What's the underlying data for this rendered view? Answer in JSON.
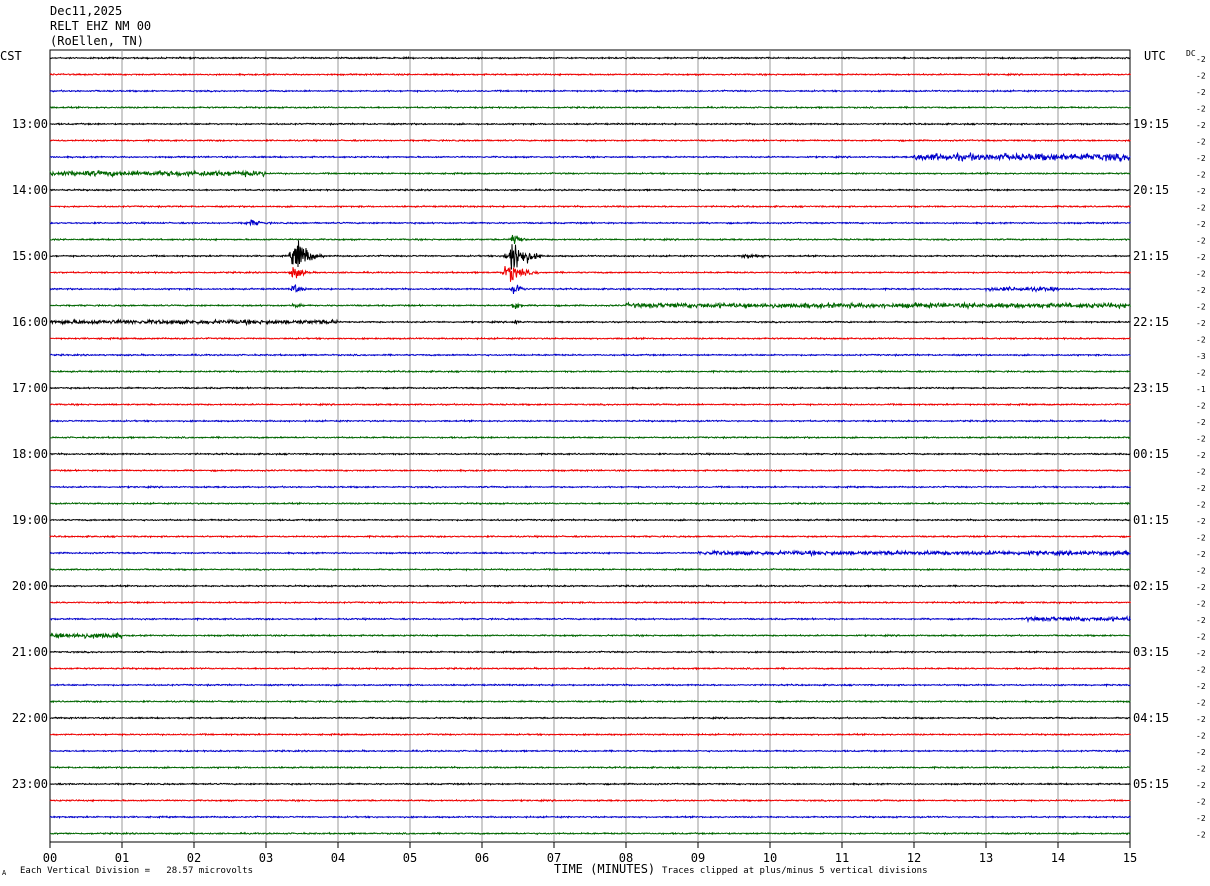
{
  "header": {
    "date": "Dec11,2025",
    "station": "RELT EHZ NM 00",
    "location": "(RoEllen, TN)"
  },
  "left_timezone": "CST",
  "right_timezone": "UTC",
  "dc_label": "DC",
  "footer": {
    "scale_note": "Each Vertical Division =   28.57 microvolts",
    "xlabel": "TIME (MINUTES)",
    "clip_note": "Traces clipped at plus/minus 5 vertical divisions",
    "corner_mark": "A"
  },
  "chart_data": {
    "type": "line",
    "title": "RELT EHZ NM 00",
    "xlabel": "TIME (MINUTES)",
    "xlim": [
      0,
      15
    ],
    "x_ticks": [
      "00",
      "01",
      "02",
      "03",
      "04",
      "05",
      "06",
      "07",
      "08",
      "09",
      "10",
      "11",
      "12",
      "13",
      "14",
      "15"
    ],
    "grid": true,
    "trace_minutes": 15,
    "trace_colors": [
      "#000000",
      "#ee0000",
      "#0000cc",
      "#006600"
    ],
    "left_hour_labels": [
      "13:00",
      "14:00",
      "15:00",
      "16:00",
      "17:00",
      "18:00",
      "19:00",
      "20:00",
      "21:00",
      "22:00",
      "23:00"
    ],
    "right_hour_labels": [
      "19:15",
      "20:15",
      "21:15",
      "22:15",
      "23:15",
      "00:15",
      "01:15",
      "02:15",
      "03:15",
      "04:15",
      "05:15"
    ],
    "dc_offsets": [
      "-2",
      "-2",
      "-2",
      "-2",
      "-2",
      "-2",
      "-2",
      "-2",
      "-2",
      "-2",
      "-2",
      "-2",
      "-2",
      "-2",
      "-2",
      "-2",
      "-2",
      "-2",
      "-3",
      "-2",
      "-1",
      "-2",
      "-2",
      "-2",
      "-2",
      "-2",
      "-2",
      "-2",
      "-2",
      "-2",
      "-2",
      "-2",
      "-2",
      "-2",
      "-2",
      "-2",
      "-2",
      "-2",
      "-2",
      "-2",
      "-2",
      "-2",
      "-2",
      "-2",
      "-2",
      "-2",
      "-2",
      "-2"
    ],
    "events": [
      {
        "trace": 12,
        "minute": 3.45,
        "width": 0.35,
        "amp": 3.2
      },
      {
        "trace": 13,
        "minute": 3.4,
        "width": 0.25,
        "amp": 1.2
      },
      {
        "trace": 14,
        "minute": 3.4,
        "width": 0.2,
        "amp": 0.8
      },
      {
        "trace": 15,
        "minute": 3.4,
        "width": 0.15,
        "amp": 0.5
      },
      {
        "trace": 12,
        "minute": 6.45,
        "width": 0.4,
        "amp": 3.4
      },
      {
        "trace": 11,
        "minute": 6.45,
        "width": 0.2,
        "amp": 1.2
      },
      {
        "trace": 13,
        "minute": 6.4,
        "width": 0.4,
        "amp": 1.6
      },
      {
        "trace": 14,
        "minute": 6.45,
        "width": 0.2,
        "amp": 1.4
      },
      {
        "trace": 15,
        "minute": 6.45,
        "width": 0.15,
        "amp": 1.0
      },
      {
        "trace": 16,
        "minute": 6.45,
        "width": 0.1,
        "amp": 0.6
      },
      {
        "trace": 10,
        "minute": 2.8,
        "width": 0.3,
        "amp": 0.5
      },
      {
        "trace": 12,
        "minute": 9.7,
        "width": 0.4,
        "amp": 0.35
      }
    ],
    "noisy_segments": [
      {
        "trace": 6,
        "from": 12.0,
        "to": 15.0,
        "amp": 0.6
      },
      {
        "trace": 7,
        "from": 0.0,
        "to": 3.0,
        "amp": 0.45
      },
      {
        "trace": 14,
        "from": 13.0,
        "to": 14.0,
        "amp": 0.35
      },
      {
        "trace": 15,
        "from": 8.0,
        "to": 15.0,
        "amp": 0.4
      },
      {
        "trace": 16,
        "from": 0.0,
        "to": 4.0,
        "amp": 0.35
      },
      {
        "trace": 30,
        "from": 9.0,
        "to": 15.0,
        "amp": 0.35
      },
      {
        "trace": 34,
        "from": 13.5,
        "to": 15.0,
        "amp": 0.35
      },
      {
        "trace": 35,
        "from": 0.0,
        "to": 1.0,
        "amp": 0.45
      }
    ]
  }
}
